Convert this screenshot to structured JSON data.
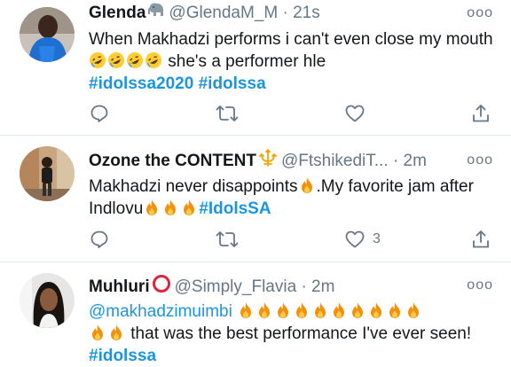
{
  "tweets": [
    {
      "name": "Glenda",
      "badge": "elephant-emoji",
      "handle": "@GlendaM_M",
      "dot": "·",
      "time": "21s",
      "text_a": "When Makhadzi performs i can't even close my mouth",
      "emoji_a": "rofl-emoji",
      "emoji_a_count": 4,
      "text_b": "she's a performer hle",
      "hashtags": [
        "#idolssa2020",
        "#idolssa"
      ],
      "like_count": ""
    },
    {
      "name": "Ozone the CONTENT",
      "badge": "trident-emblem",
      "handle": "@FtshikediT...",
      "dot": "·",
      "time": "2m",
      "text_a": "Makhadzi never disappoints",
      "text_b": ".My favorite jam after Indlovu",
      "hashtags": [
        "#IdolsSA"
      ],
      "like_count": "3"
    },
    {
      "name": "Muhluri",
      "badge": "red-circle",
      "handle": "@Simply_Flavia",
      "dot": "·",
      "time": "2m",
      "mention": "@makhadzimuimbi",
      "text_b": "that was the best performance I've ever seen!",
      "hashtags": [
        "#idolssa"
      ],
      "like_count": ""
    }
  ],
  "more_label": "ooo",
  "colors": {
    "link": "#1b95e0",
    "secondary": "#657786",
    "divider": "#e1e8ed"
  }
}
